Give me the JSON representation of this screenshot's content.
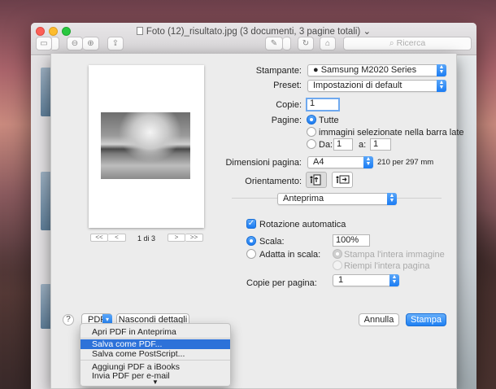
{
  "window": {
    "title": "Foto (12)_risultato.jpg (3 documenti, 3 pagine totali)",
    "title_chevron": "⌄",
    "search_placeholder": "Ricerca"
  },
  "print": {
    "printer_label": "Stampante:",
    "printer_value": "Samsung M2020 Series",
    "preset_label": "Preset:",
    "preset_value": "Impostazioni di default",
    "copies_label": "Copie:",
    "copies_value": "1",
    "pages_label": "Pagine:",
    "pages_all": "Tutte",
    "pages_selected": "immagini selezionate nella barra late",
    "pages_from": "Da:",
    "pages_from_value": "1",
    "pages_to": "a:",
    "pages_to_value": "1",
    "paper_size_label": "Dimensioni pagina:",
    "paper_size_value": "A4",
    "paper_size_desc": "210 per 297 mm",
    "orientation_label": "Orientamento:",
    "section_value": "Anteprima",
    "auto_rotate": "Rotazione automatica",
    "scale_label": "Scala:",
    "scale_value": "100%",
    "fit_label": "Adatta in scala:",
    "fit_option_1": "Stampa l'intera immagine",
    "fit_option_2": "Riempi l'intera pagina",
    "copies_per_page_label": "Copie per pagina:",
    "copies_per_page_value": "1",
    "page_indicator": "1 di 3",
    "pager_first": "<<",
    "pager_prev": "<",
    "pager_next": ">",
    "pager_last": ">>",
    "help": "?",
    "pdf_button": "PDF",
    "hide_details": "Nascondi dettagli",
    "cancel": "Annulla",
    "print": "Stampa"
  },
  "pdf_menu": {
    "items": [
      "Apri PDF in Anteprima",
      "Salva come PDF...",
      "Salva come PostScript...",
      "Aggiungi PDF a iBooks",
      "Invia PDF per e-mail"
    ],
    "highlighted_index": 1,
    "more_arrow": "▼"
  },
  "colors": {
    "accent": "#1e80f3",
    "menu_highlight": "#2d72d9"
  }
}
